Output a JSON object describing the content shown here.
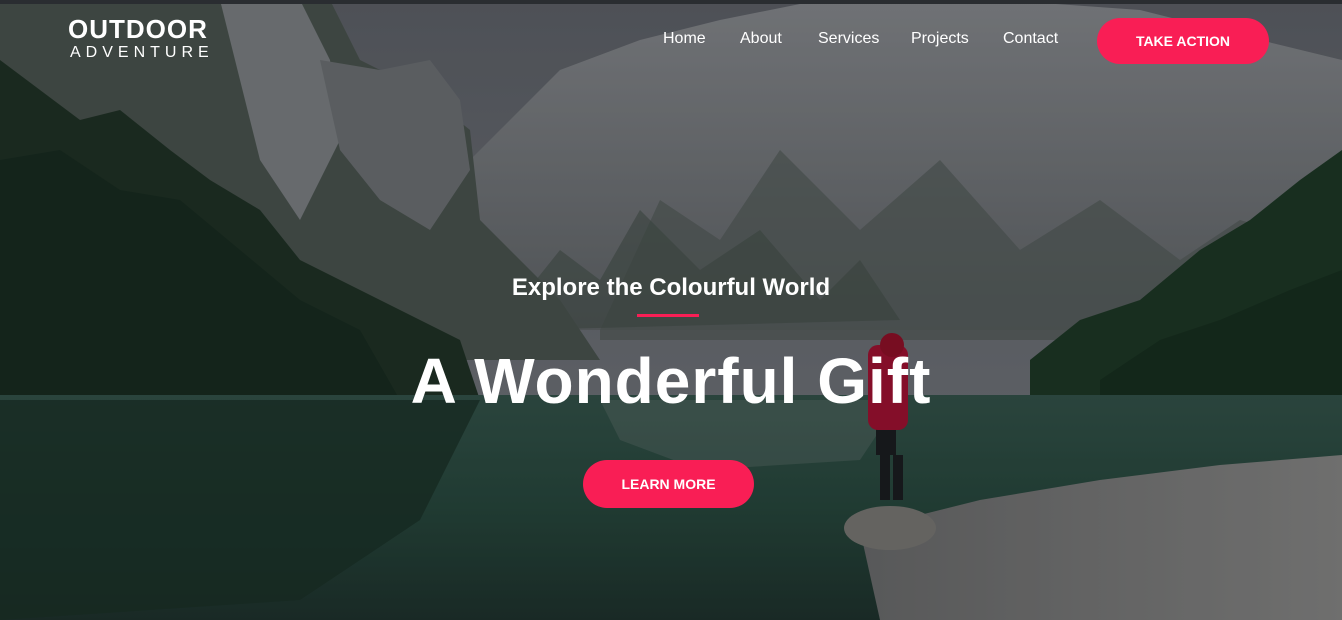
{
  "logo": {
    "line1": "OUTDOOR",
    "line2": "ADVENTURE"
  },
  "nav": {
    "items": [
      {
        "label": "Home"
      },
      {
        "label": "About"
      },
      {
        "label": "Services"
      },
      {
        "label": "Projects"
      },
      {
        "label": "Contact"
      }
    ],
    "cta_label": "TAKE ACTION"
  },
  "hero": {
    "subtitle": "Explore the Colourful World",
    "title": "A Wonderful Gift",
    "button_label": "LEARN MORE",
    "background_image": "mountain-lake-hiker-photo"
  },
  "colors": {
    "accent": "#f91e55",
    "text": "#ffffff"
  }
}
